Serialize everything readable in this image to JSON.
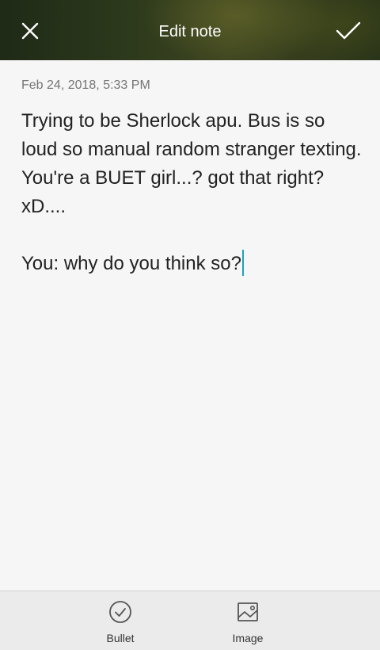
{
  "header": {
    "title": "Edit note",
    "close_icon": "close-icon",
    "save_icon": "checkmark-icon"
  },
  "note": {
    "timestamp": "Feb 24, 2018, 5:33 PM",
    "body": "Trying to be Sherlock apu. Bus is so loud so manual random stranger texting.  You're a BUET girl...? got that right? xD....\n\nYou: why do you think so?"
  },
  "toolbar": {
    "bullet_label": "Bullet",
    "image_label": "Image",
    "bullet_icon": "check-circle-icon",
    "image_icon": "image-icon"
  },
  "colors": {
    "caret": "#1aa3b8",
    "text": "#222222",
    "timestamp": "#757575"
  }
}
